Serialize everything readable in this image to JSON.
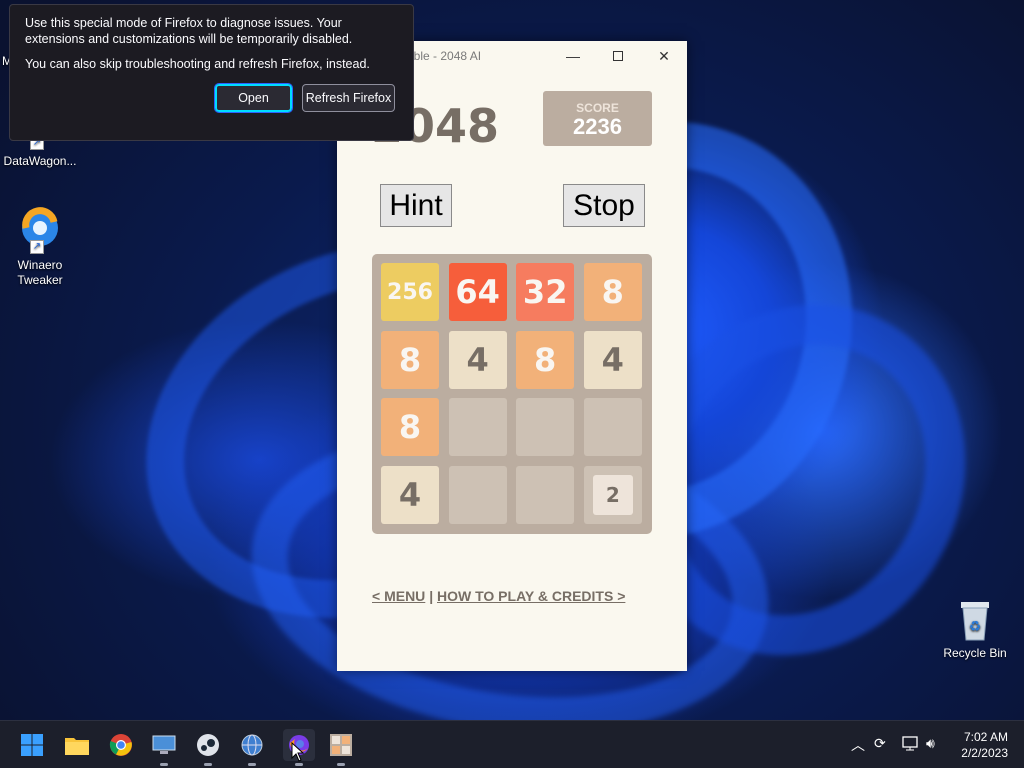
{
  "desktop": {
    "icons": [
      {
        "label": "DataWagon...",
        "icon": "datawagon-icon"
      },
      {
        "label": "Winaero Tweaker",
        "icon": "winaero-tweaker-icon"
      },
      {
        "label": "Recycle Bin",
        "icon": "recycle-bin-icon"
      }
    ],
    "partial_icon_label": "M"
  },
  "app_window": {
    "title": "able - 2048 AI",
    "game_title": "2048",
    "score_label": "SCORE",
    "score_value": "2236",
    "hint_label": "Hint",
    "stop_label": "Stop",
    "board": [
      [
        "256",
        "64",
        "32",
        "8"
      ],
      [
        "8",
        "4",
        "8",
        "4"
      ],
      [
        "8",
        "",
        "",
        ""
      ],
      [
        "4",
        "",
        "",
        "2"
      ]
    ],
    "footer": {
      "menu_link": "< MENU",
      "separator": "|",
      "how_link": "HOW TO PLAY & CREDITS >"
    }
  },
  "firefox_popup": {
    "message": "Use this special mode of Firefox to diagnose issues. Your extensions and customizations will be temporarily disabled.",
    "secondary": "You can also skip troubleshooting and refresh Firefox, instead.",
    "open_label": "Open",
    "refresh_label": "Refresh Firefox"
  },
  "taskbar": {
    "apps": [
      "start-icon",
      "file-explorer-icon",
      "chrome-icon",
      "remote-desktop-icon",
      "steam-icon",
      "network-globe-icon",
      "firefox-icon",
      "calculator-app-icon"
    ],
    "clock_time": "7:02 AM",
    "clock_date": "2/2/2023"
  },
  "colors": {
    "tile_256": "#edcc61",
    "tile_64": "#f65e3b",
    "tile_32": "#f67c5f",
    "tile_8": "#f2b179",
    "tile_4": "#ede0c8",
    "tile_2": "#eee4da",
    "tile_empty": "#cdc1b4"
  }
}
